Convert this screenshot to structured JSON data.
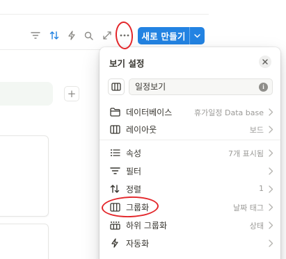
{
  "toolbar": {
    "icons": [
      "filter-icon",
      "sort-icon",
      "automation-icon",
      "search-icon",
      "expand-icon",
      "more-icon"
    ],
    "new_button_label": "새로 만들기",
    "accent_color": "#2383e2"
  },
  "board": {
    "add_group_label": "+"
  },
  "view_settings": {
    "title": "보기 설정",
    "view_name": "일정보기",
    "rows": [
      {
        "label": "데이터베이스",
        "value": "휴가일정 Data base",
        "icon": "folder-icon"
      },
      {
        "label": "레이아웃",
        "value": "보드",
        "icon": "board-layout-icon"
      },
      {
        "label": "속성",
        "value": "7개 표시됨",
        "icon": "list-icon"
      },
      {
        "label": "필터",
        "value": "",
        "icon": "filter-icon"
      },
      {
        "label": "정렬",
        "value": "1",
        "icon": "sort-icon"
      },
      {
        "label": "그룹화",
        "value": "날짜 태그",
        "icon": "board-layout-icon"
      },
      {
        "label": "하위 그룹화",
        "value": "상태",
        "icon": "grid-icon"
      },
      {
        "label": "자동화",
        "value": "",
        "icon": "automation-icon"
      }
    ]
  },
  "annotation_color": "#e3262a"
}
